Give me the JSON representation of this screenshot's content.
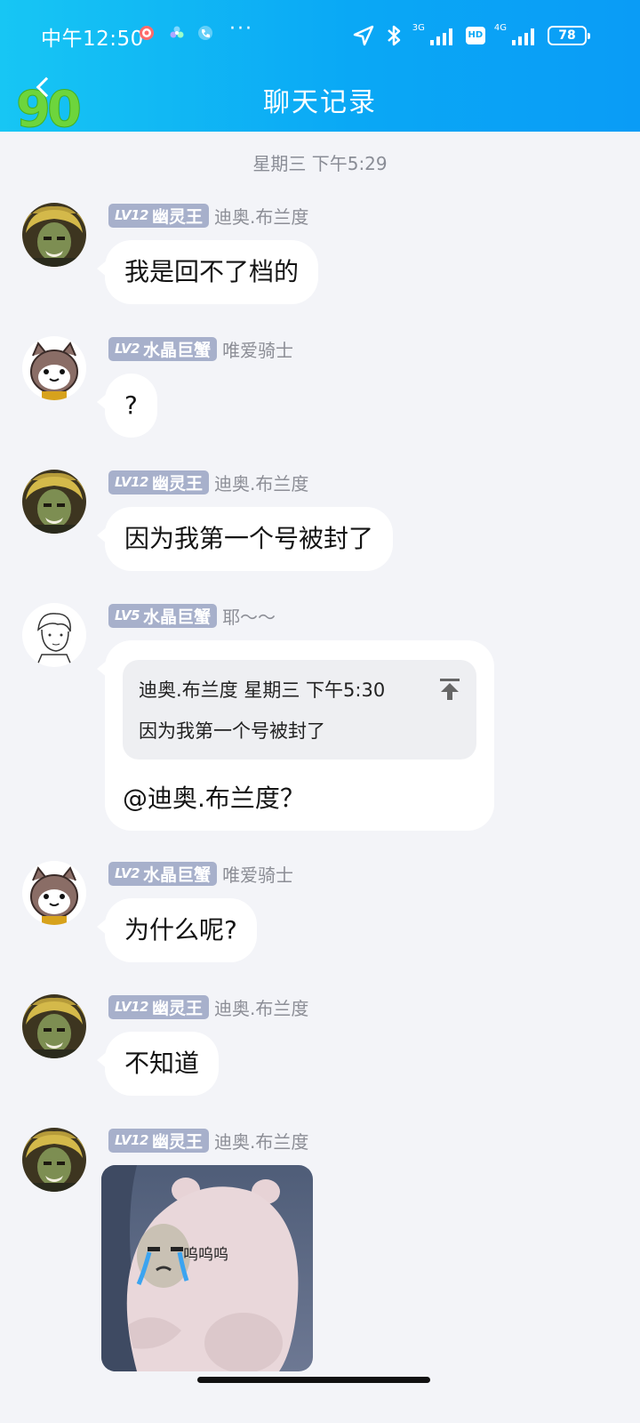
{
  "status_bar": {
    "time": "中午12:50",
    "dots": "···",
    "net1": "3G",
    "hd": "HD",
    "net2": "4G",
    "battery": "78"
  },
  "header": {
    "title": "聊天记录"
  },
  "timestamp": "星期三 下午5:29",
  "messages": [
    {
      "level": "LV12",
      "title": "幽灵王",
      "nick": "迪奥.布兰度",
      "text": "我是回不了档的"
    },
    {
      "level": "LV2",
      "title": "水晶巨蟹",
      "nick": "唯爱骑士",
      "text": "?"
    },
    {
      "level": "LV12",
      "title": "幽灵王",
      "nick": "迪奥.布兰度",
      "text": "因为我第一个号被封了"
    },
    {
      "level": "LV5",
      "title": "水晶巨蟹",
      "nick": "耶～～",
      "quote_head": "迪奥.布兰度 星期三 下午5:30",
      "quote_body": "因为我第一个号被封了",
      "text": "@迪奥.布兰度？"
    },
    {
      "level": "LV2",
      "title": "水晶巨蟹",
      "nick": "唯爱骑士",
      "text": "为什么呢?"
    },
    {
      "level": "LV12",
      "title": "幽灵王",
      "nick": "迪奥.布兰度",
      "text": "不知道"
    },
    {
      "level": "LV12",
      "title": "幽灵王",
      "nick": "迪奥.布兰度",
      "sticker_caption": "呜呜呜"
    }
  ]
}
